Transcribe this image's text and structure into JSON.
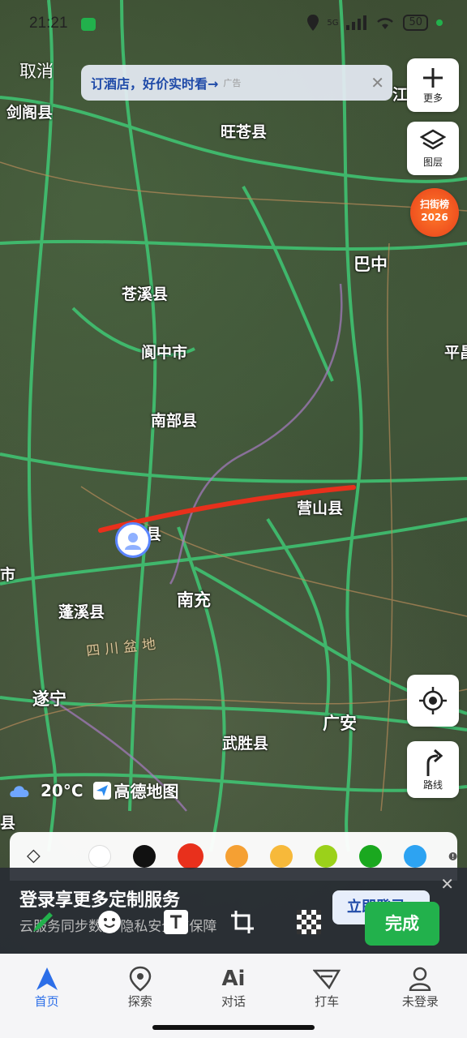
{
  "status_bar": {
    "time": "21:21",
    "network": "5G",
    "battery": "50"
  },
  "top": {
    "cancel_label": "取消"
  },
  "ad": {
    "text": "订酒店，好价实时看→",
    "tag": "广告"
  },
  "side": {
    "more_label": "更多",
    "layers_label": "图层",
    "rank_line1": "扫街榜",
    "rank_line2": "2026",
    "route_label": "路线"
  },
  "map_labels": {
    "jiange": "剑阁县",
    "wangcang": "旺苍县",
    "bazhong": "巴中",
    "cangxi": "苍溪县",
    "langzhong": "阆中市",
    "ping": "平昌",
    "nanbu": "南部县",
    "yingshan": "营山县",
    "nanchong": "南充",
    "pengxi": "蓬溪县",
    "basin": "四川盆地",
    "suining": "遂宁",
    "guangan": "广安",
    "wusheng": "武胜县",
    "shi": "市",
    "xian_left": "县",
    "xian_avatar": "县",
    "jiang": "江"
  },
  "weather": {
    "temp": "20°C",
    "brand": "高德地图"
  },
  "palette": {
    "colors": [
      "#ffffff",
      "#111111",
      "#e8301c",
      "#f5a033",
      "#f7b93a",
      "#9bd11a",
      "#1aa81f",
      "#2da3f2"
    ],
    "selected": "#e8301c"
  },
  "banner": {
    "title": "登录享更多定制服务",
    "subtitle": "云服务同步数据 隐私安全有保障",
    "login_label": "立即登录"
  },
  "done_label": "完成",
  "tabs": [
    {
      "label": "首页",
      "icon": "navigation-arrow-icon",
      "active": true
    },
    {
      "label": "探索",
      "icon": "map-pin-icon",
      "active": false
    },
    {
      "label": "对话",
      "icon": "ai-chat-icon",
      "active": false
    },
    {
      "label": "打车",
      "icon": "taxi-icon",
      "active": false
    },
    {
      "label": "未登录",
      "icon": "user-icon",
      "active": false
    }
  ]
}
